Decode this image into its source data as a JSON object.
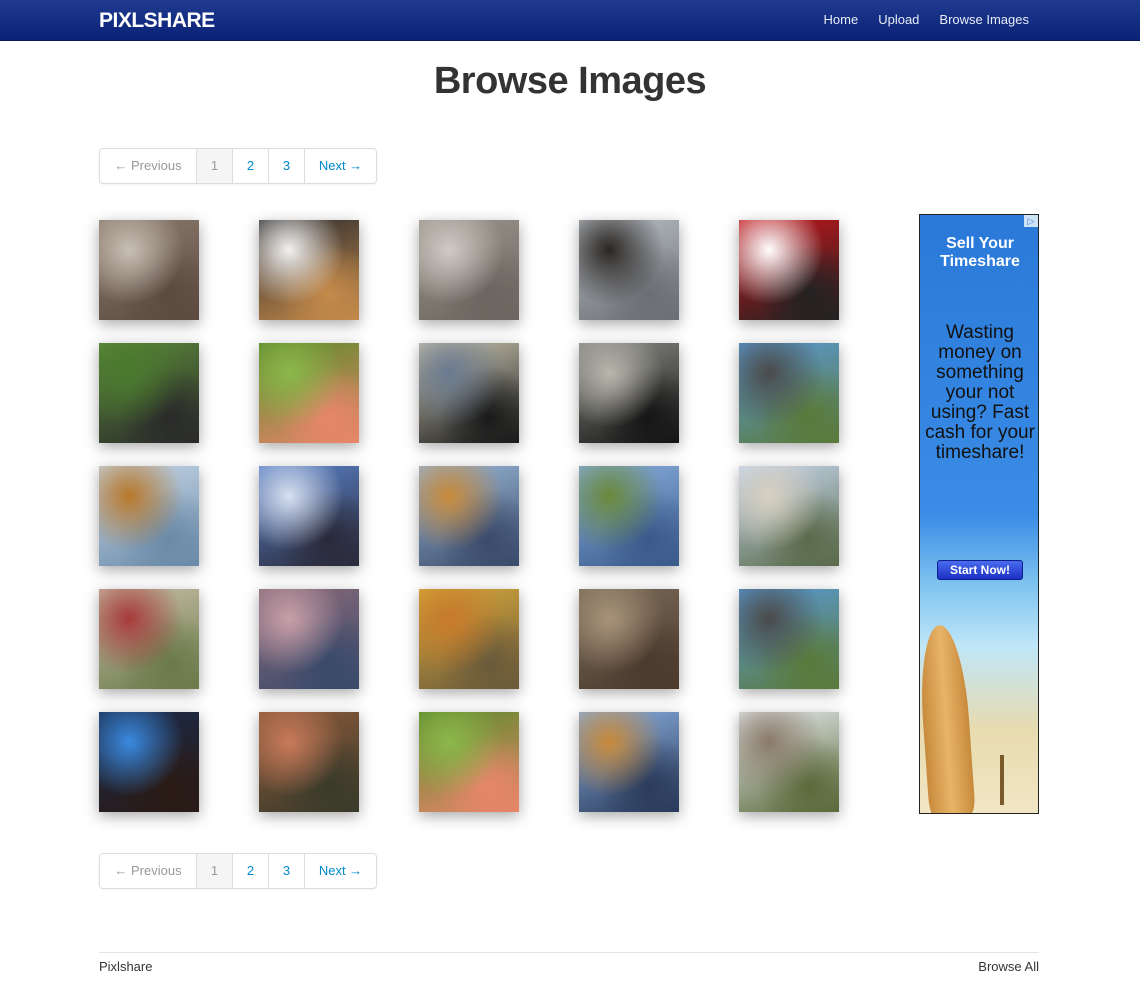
{
  "nav": {
    "brand": "PIXLSHARE",
    "links": [
      "Home",
      "Upload",
      "Browse Images"
    ]
  },
  "page_title": "Browse Images",
  "pagination": {
    "prev": "← Previous",
    "pages": [
      "1",
      "2",
      "3"
    ],
    "active_page": "1",
    "next": "Next →"
  },
  "images": [
    {
      "name": "image-thumb-brochures",
      "colors": [
        "#8b7b6e",
        "#c9bfb4",
        "#5a4a40"
      ]
    },
    {
      "name": "image-thumb-granola-bar",
      "colors": [
        "#2b2b2e",
        "#f2f2f2",
        "#c48a4a"
      ]
    },
    {
      "name": "image-thumb-package-doorway",
      "colors": [
        "#9a948c",
        "#cfcbc4",
        "#6a655e"
      ]
    },
    {
      "name": "image-thumb-dog-window",
      "colors": [
        "#b9bfc6",
        "#2a2622",
        "#6b6e73"
      ]
    },
    {
      "name": "image-thumb-cnn-screenshot",
      "colors": [
        "#c4161c",
        "#ffffff",
        "#222222"
      ]
    },
    {
      "name": "image-thumb-dog-lawn",
      "colors": [
        "#5c8a3a",
        "#4a7a2e",
        "#2a2a2a"
      ]
    },
    {
      "name": "image-thumb-flower",
      "colors": [
        "#5a8a2a",
        "#8ab84a",
        "#e8866a"
      ]
    },
    {
      "name": "image-thumb-sunset-skyline",
      "colors": [
        "#c9c5b0",
        "#6a7a90",
        "#1a1a1a"
      ]
    },
    {
      "name": "image-thumb-dog-floor",
      "colors": [
        "#8a8a84",
        "#b9b6ad",
        "#151515"
      ]
    },
    {
      "name": "image-thumb-cathedral",
      "colors": [
        "#5a9ad8",
        "#4a4a4a",
        "#5a7a3a"
      ]
    },
    {
      "name": "image-thumb-canal-autumn",
      "colors": [
        "#c8d8e8",
        "#b8782a",
        "#6a8aa8"
      ]
    },
    {
      "name": "image-thumb-eiffel-tower",
      "colors": [
        "#5a82c8",
        "#d8e0f0",
        "#2a2a3a"
      ]
    },
    {
      "name": "image-thumb-canal-trees",
      "colors": [
        "#9ab8d8",
        "#c88a3a",
        "#3a4a6a"
      ]
    },
    {
      "name": "image-thumb-canal-path",
      "colors": [
        "#8ab0e0",
        "#6a8a3a",
        "#3a5a8a"
      ]
    },
    {
      "name": "image-thumb-washington-arch",
      "colors": [
        "#c8d8f0",
        "#d8d0c0",
        "#5a6a4a"
      ]
    },
    {
      "name": "image-thumb-red-maple",
      "colors": [
        "#c8c0a8",
        "#a83a3a",
        "#6a7a4a"
      ]
    },
    {
      "name": "image-thumb-pond-reflection",
      "colors": [
        "#8a6a7a",
        "#c8a0a8",
        "#3a4a6a"
      ]
    },
    {
      "name": "image-thumb-autumn-canopy",
      "colors": [
        "#d8a83a",
        "#c87a2a",
        "#6a5a3a"
      ]
    },
    {
      "name": "image-thumb-catacomb-skulls",
      "colors": [
        "#7a6a58",
        "#a8947a",
        "#4a3a2e"
      ]
    },
    {
      "name": "image-thumb-cathedral-2",
      "colors": [
        "#5a9ad8",
        "#4a4a4a",
        "#5a7a3a"
      ]
    },
    {
      "name": "image-thumb-gothic-window",
      "colors": [
        "#1a2a4a",
        "#3a8ae0",
        "#2a1a14"
      ]
    },
    {
      "name": "image-thumb-autumn-leaves",
      "colors": [
        "#8a5a3a",
        "#c87a5a",
        "#3a3a2a"
      ]
    },
    {
      "name": "image-thumb-flower-2",
      "colors": [
        "#5a8a2a",
        "#8ab84a",
        "#e8866a"
      ]
    },
    {
      "name": "image-thumb-river-autumn",
      "colors": [
        "#8ab0e0",
        "#c88a3a",
        "#2a3a5a"
      ]
    },
    {
      "name": "image-thumb-abbey-ruins",
      "colors": [
        "#e8ecf0",
        "#8a7a6a",
        "#5a6a3a"
      ]
    }
  ],
  "ad": {
    "badge": "▷",
    "headline": "Sell Your Timeshare",
    "body": "Wasting money on something your not using? Fast cash for your timeshare!",
    "button": "Start Now!"
  },
  "footer": {
    "left": "Pixlshare",
    "right": "Browse All"
  }
}
